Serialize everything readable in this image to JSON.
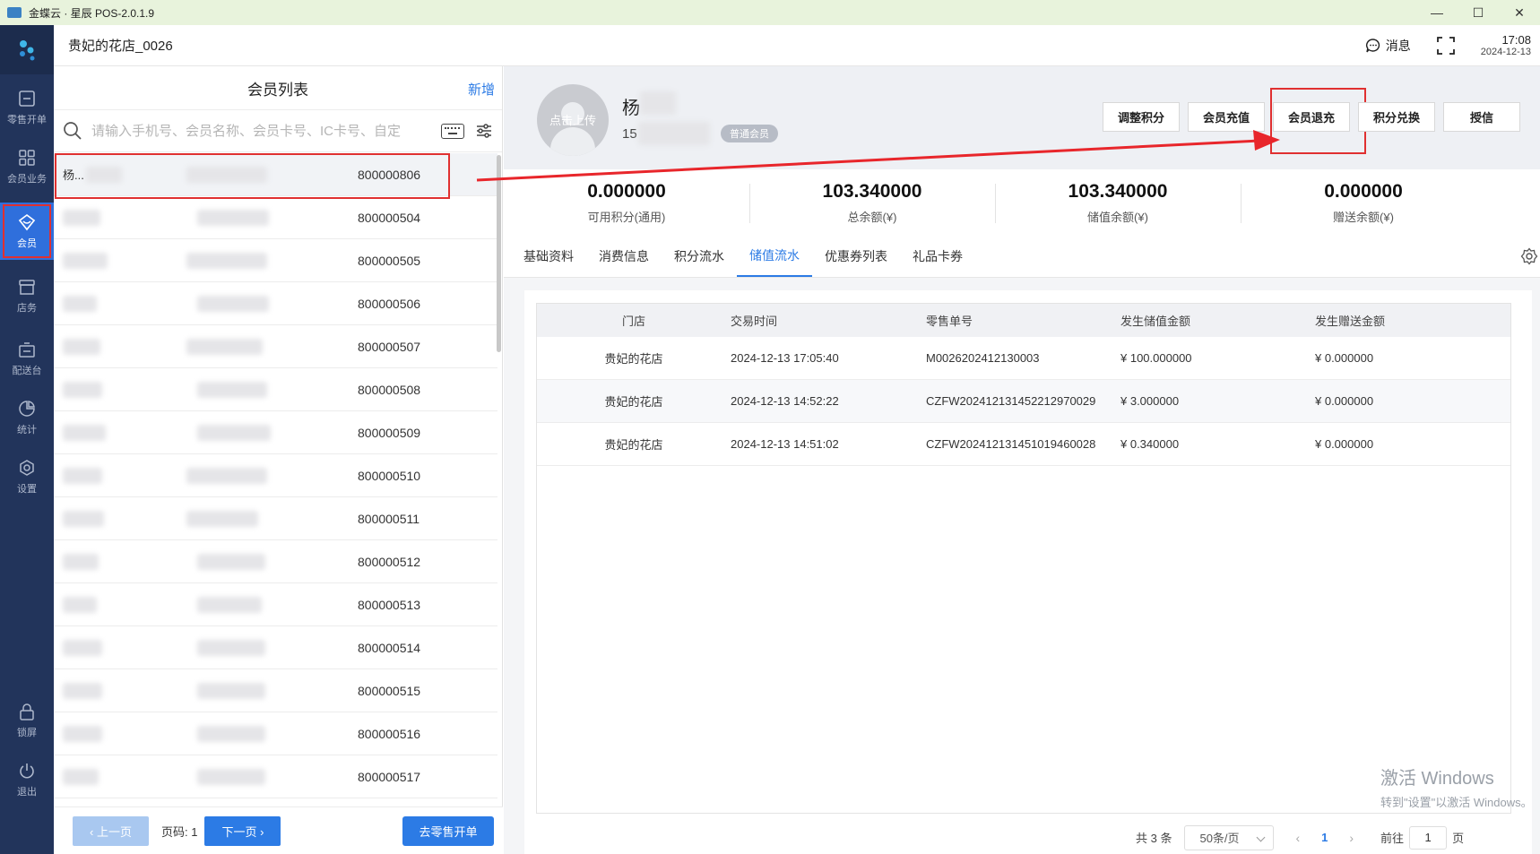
{
  "window": {
    "title": "金蝶云 · 星辰 POS-2.0.1.9",
    "minimize": "—",
    "maximize": "☐",
    "close": "✕"
  },
  "nav": {
    "items": [
      {
        "label": "零售开单",
        "icon": "cashier-icon"
      },
      {
        "label": "会员业务",
        "icon": "grid-icon"
      },
      {
        "label": "会员",
        "icon": "member-icon",
        "active": true
      },
      {
        "label": "店务",
        "icon": "store-icon"
      },
      {
        "label": "配送台",
        "icon": "delivery-icon"
      },
      {
        "label": "统计",
        "icon": "chart-icon"
      },
      {
        "label": "设置",
        "icon": "settings-icon"
      },
      {
        "label": "锁屏",
        "icon": "lock-icon"
      },
      {
        "label": "退出",
        "icon": "power-icon"
      }
    ]
  },
  "header": {
    "store_name": "贵妃的花店_0026",
    "message": "消息",
    "time": "17:08",
    "date": "2024-12-13"
  },
  "member_list": {
    "title": "会员列表",
    "add": "新增",
    "search_placeholder": "请输入手机号、会员名称、会员卡号、IC卡号、自定",
    "rows": [
      {
        "name": "杨...",
        "card": "800000806"
      },
      {
        "name": "",
        "card": "800000504"
      },
      {
        "name": "",
        "card": "800000505"
      },
      {
        "name": "",
        "card": "800000506"
      },
      {
        "name": "",
        "card": "800000507"
      },
      {
        "name": "",
        "card": "800000508"
      },
      {
        "name": "",
        "card": "800000509"
      },
      {
        "name": "",
        "card": "800000510"
      },
      {
        "name": "",
        "card": "800000511"
      },
      {
        "name": "",
        "card": "800000512"
      },
      {
        "name": "",
        "card": "800000513"
      },
      {
        "name": "",
        "card": "800000514"
      },
      {
        "name": "",
        "card": "800000515"
      },
      {
        "name": "",
        "card": "800000516"
      },
      {
        "name": "",
        "card": "800000517"
      }
    ],
    "prev": "‹ 上一页",
    "page_label": "页码: 1",
    "next": "下一页 ›",
    "go_retail": "去零售开单"
  },
  "profile": {
    "upload": "点击上传",
    "name": "杨",
    "phone": "15",
    "level": "普通会员",
    "actions": [
      "调整积分",
      "会员充值",
      "会员退充",
      "积分兑换",
      "授信"
    ]
  },
  "stats": [
    {
      "value": "0.000000",
      "label": "可用积分(通用)"
    },
    {
      "value": "103.340000",
      "label": "总余额(¥)"
    },
    {
      "value": "103.340000",
      "label": "储值余额(¥)"
    },
    {
      "value": "0.000000",
      "label": "赠送余额(¥)"
    }
  ],
  "tabs": [
    "基础资料",
    "消费信息",
    "积分流水",
    "储值流水",
    "优惠券列表",
    "礼品卡券"
  ],
  "active_tab": 3,
  "table": {
    "headers": [
      "门店",
      "交易时间",
      "零售单号",
      "发生储值金额",
      "发生赠送金额"
    ],
    "rows": [
      [
        "贵妃的花店",
        "2024-12-13 17:05:40",
        "M0026202412130003",
        "¥  100.000000",
        "¥  0.000000"
      ],
      [
        "贵妃的花店",
        "2024-12-13 14:52:22",
        "CZFW202412131452212970029",
        "¥  3.000000",
        "¥  0.000000"
      ],
      [
        "贵妃的花店",
        "2024-12-13 14:51:02",
        "CZFW202412131451019460028",
        "¥  0.340000",
        "¥  0.000000"
      ]
    ]
  },
  "table_footer": {
    "total": "共 3 条",
    "per_page": "50条/页",
    "current_page": "1",
    "goto": "前往",
    "goto_value": "1",
    "page_unit": "页"
  },
  "watermark": {
    "line1": "激活 Windows",
    "line2": "转到\"设置\"以激活 Windows。"
  },
  "colors": {
    "primary": "#2c7be5",
    "nav_bg": "#22345b",
    "highlight": "#e03030"
  }
}
